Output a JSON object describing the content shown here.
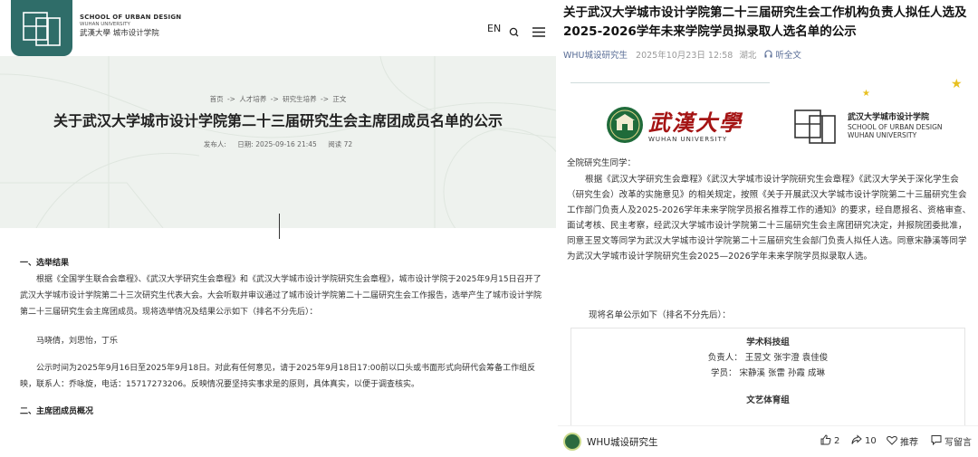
{
  "left": {
    "header": {
      "logo_en_line1": "SCHOOL OF URBAN DESIGN",
      "logo_en_line2": "WUHAN UNIVERSITY",
      "logo_cn": "武漢大學  城市设计学院",
      "lang": "EN"
    },
    "breadcrumb": [
      "首页",
      "->",
      "人才培养",
      "->",
      "研究生培养",
      "->",
      "正文"
    ],
    "title": "关于武汉大学城市设计学院第二十三届研究生会主席团成员名单的公示",
    "meta": {
      "publisher": "发布人:",
      "date": "日期: 2025-09-16 21:45",
      "views": "阅读 72"
    },
    "body": {
      "section1_heading": "一、选举结果",
      "paragraph1": "根据《全国学生联合会章程》、《武汉大学研究生会章程》和《武汉大学城市设计学院研究生会章程》，城市设计学院于2025年9月15日召开了武汉大学城市设计学院第二十三次研究生代表大会。大会听取并审议通过了城市设计学院第二十二届研究生会工作报告，选举产生了城市设计学院第二十三届研究生会主席团成员。现将选举情况及结果公示如下（排名不分先后）：",
      "names": "马晓倩，刘思怡，丁乐",
      "notice": "公示时间为2025年9月16日至2025年9月18日。对此有任何意见，请于2025年9月18日17:00前以口头或书面形式向研代会筹备工作组反映，联系人：乔咏旋，电话：15717273206。反映情况要坚持实事求是的原则，具体真实，以便于调查核实。",
      "section2_heading": "二、主席团成员概况"
    }
  },
  "right": {
    "title": "关于武汉大学城市设计学院第二十三届研究生会工作机构负责人拟任人选及2025-2026学年未来学院学员拟录取人选名单的公示",
    "meta": {
      "account": "WHU城设研究生",
      "time": "2025年10月23日 12:58",
      "location": "湖北",
      "listen": "听全文"
    },
    "logos": {
      "whu_cn": "武漢大學",
      "whu_en": "WUHAN UNIVERSITY",
      "sud_cn": "武汉大学城市设计学院",
      "sud_en1": "SCHOOL OF URBAN DESIGN",
      "sud_en2": "WUHAN UNIVERSITY"
    },
    "body": {
      "greeting": "全院研究生同学：",
      "paragraph": "根据《武汉大学研究生会章程》《武汉大学城市设计学院研究生会章程》《武汉大学关于深化学生会（研究生会）改革的实施意见》的相关规定，按照《关于开展武汉大学城市设计学院第二十三届研究生会工作部门负责人及2025-2026学年未来学院学员报名推荐工作的通知》的要求，经自愿报名、资格审查、面试考核、民主考察，经武汉大学城市设计学院第二十三届研究生会主席团研究决定，并报院团委批准，同意王昱文等同学为武汉大学城市设计学院第二十三届研究生会部门负责人拟任人选。同意宋静溪等同学为武汉大学城市设计学院研究生会2025—2026学年未来学院学员拟录取人选。",
      "list_intro": "现将名单公示如下（排名不分先后）："
    },
    "list": {
      "group1": "学术科技组",
      "group1_leaders": "负责人： 王昱文  张宇澄  袁佳俊",
      "group1_members": "学员： 宋静溪  张雷  孙霞  成琳",
      "group2": "文艺体育组"
    },
    "bottom_bar": {
      "account": "WHU城设研究生",
      "likes": "2",
      "shares": "10",
      "love": "推荐",
      "comment": "写留言"
    }
  }
}
